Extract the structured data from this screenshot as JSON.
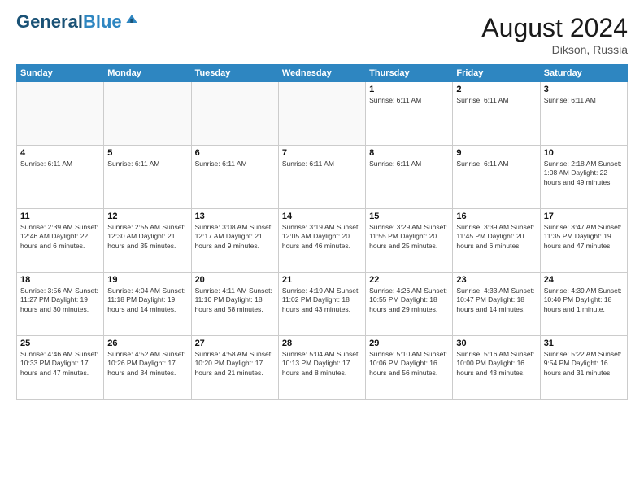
{
  "header": {
    "logo_general": "General",
    "logo_blue": "Blue",
    "month_year": "August 2024",
    "location": "Dikson, Russia"
  },
  "weekdays": [
    "Sunday",
    "Monday",
    "Tuesday",
    "Wednesday",
    "Thursday",
    "Friday",
    "Saturday"
  ],
  "weeks": [
    [
      {
        "day": "",
        "info": ""
      },
      {
        "day": "",
        "info": ""
      },
      {
        "day": "",
        "info": ""
      },
      {
        "day": "",
        "info": ""
      },
      {
        "day": "1",
        "info": "Sunrise: 6:11 AM"
      },
      {
        "day": "2",
        "info": "Sunrise: 6:11 AM"
      },
      {
        "day": "3",
        "info": "Sunrise: 6:11 AM"
      }
    ],
    [
      {
        "day": "4",
        "info": "Sunrise: 6:11 AM"
      },
      {
        "day": "5",
        "info": "Sunrise: 6:11 AM"
      },
      {
        "day": "6",
        "info": "Sunrise: 6:11 AM"
      },
      {
        "day": "7",
        "info": "Sunrise: 6:11 AM"
      },
      {
        "day": "8",
        "info": "Sunrise: 6:11 AM"
      },
      {
        "day": "9",
        "info": "Sunrise: 6:11 AM"
      },
      {
        "day": "10",
        "info": "Sunrise: 2:18 AM\nSunset: 1:08 AM\nDaylight: 22 hours and 49 minutes."
      }
    ],
    [
      {
        "day": "11",
        "info": "Sunrise: 2:39 AM\nSunset: 12:46 AM\nDaylight: 22 hours and 6 minutes."
      },
      {
        "day": "12",
        "info": "Sunrise: 2:55 AM\nSunset: 12:30 AM\nDaylight: 21 hours and 35 minutes."
      },
      {
        "day": "13",
        "info": "Sunrise: 3:08 AM\nSunset: 12:17 AM\nDaylight: 21 hours and 9 minutes."
      },
      {
        "day": "14",
        "info": "Sunrise: 3:19 AM\nSunset: 12:05 AM\nDaylight: 20 hours and 46 minutes."
      },
      {
        "day": "15",
        "info": "Sunrise: 3:29 AM\nSunset: 11:55 PM\nDaylight: 20 hours and 25 minutes."
      },
      {
        "day": "16",
        "info": "Sunrise: 3:39 AM\nSunset: 11:45 PM\nDaylight: 20 hours and 6 minutes."
      },
      {
        "day": "17",
        "info": "Sunrise: 3:47 AM\nSunset: 11:35 PM\nDaylight: 19 hours and 47 minutes."
      }
    ],
    [
      {
        "day": "18",
        "info": "Sunrise: 3:56 AM\nSunset: 11:27 PM\nDaylight: 19 hours and 30 minutes."
      },
      {
        "day": "19",
        "info": "Sunrise: 4:04 AM\nSunset: 11:18 PM\nDaylight: 19 hours and 14 minutes."
      },
      {
        "day": "20",
        "info": "Sunrise: 4:11 AM\nSunset: 11:10 PM\nDaylight: 18 hours and 58 minutes."
      },
      {
        "day": "21",
        "info": "Sunrise: 4:19 AM\nSunset: 11:02 PM\nDaylight: 18 hours and 43 minutes."
      },
      {
        "day": "22",
        "info": "Sunrise: 4:26 AM\nSunset: 10:55 PM\nDaylight: 18 hours and 29 minutes."
      },
      {
        "day": "23",
        "info": "Sunrise: 4:33 AM\nSunset: 10:47 PM\nDaylight: 18 hours and 14 minutes."
      },
      {
        "day": "24",
        "info": "Sunrise: 4:39 AM\nSunset: 10:40 PM\nDaylight: 18 hours and 1 minute."
      }
    ],
    [
      {
        "day": "25",
        "info": "Sunrise: 4:46 AM\nSunset: 10:33 PM\nDaylight: 17 hours and 47 minutes."
      },
      {
        "day": "26",
        "info": "Sunrise: 4:52 AM\nSunset: 10:26 PM\nDaylight: 17 hours and 34 minutes."
      },
      {
        "day": "27",
        "info": "Sunrise: 4:58 AM\nSunset: 10:20 PM\nDaylight: 17 hours and 21 minutes."
      },
      {
        "day": "28",
        "info": "Sunrise: 5:04 AM\nSunset: 10:13 PM\nDaylight: 17 hours and 8 minutes."
      },
      {
        "day": "29",
        "info": "Sunrise: 5:10 AM\nSunset: 10:06 PM\nDaylight: 16 hours and 56 minutes."
      },
      {
        "day": "30",
        "info": "Sunrise: 5:16 AM\nSunset: 10:00 PM\nDaylight: 16 hours and 43 minutes."
      },
      {
        "day": "31",
        "info": "Sunrise: 5:22 AM\nSunset: 9:54 PM\nDaylight: 16 hours and 31 minutes."
      }
    ]
  ]
}
